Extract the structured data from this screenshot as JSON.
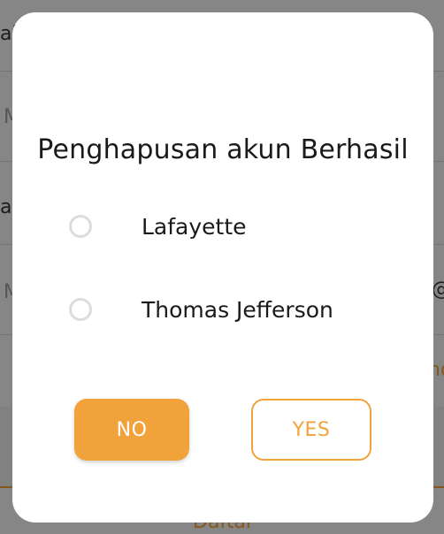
{
  "background": {
    "text_1": "ai",
    "text_2": "a",
    "hint_1": "M",
    "hint_2": "M",
    "side_icon": "@",
    "side_text": "no",
    "footer_text": "Daftar"
  },
  "dialog": {
    "title": "Penghapusan akun Berhasil",
    "options": [
      {
        "label": "Lafayette",
        "selected": false
      },
      {
        "label": "Thomas Jefferson",
        "selected": false
      }
    ],
    "buttons": {
      "no_label": "NO",
      "yes_label": "YES"
    }
  },
  "colors": {
    "accent": "#f2a23b",
    "text": "#1a1a1a",
    "radio_border": "#dcdcdc"
  }
}
